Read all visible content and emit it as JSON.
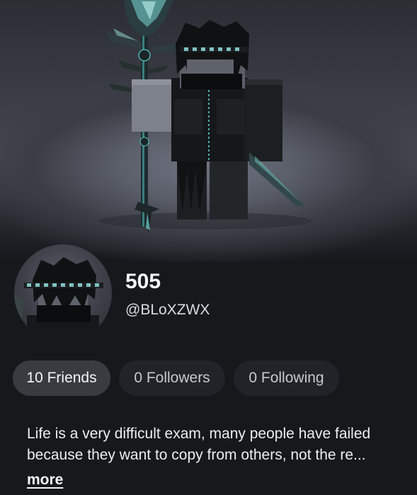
{
  "profile": {
    "display_name": "505",
    "username": "@BLoXZWX"
  },
  "stats": {
    "friends_label": "10 Friends",
    "followers_label": "0 Followers",
    "following_label": "0 Following",
    "active": "friends"
  },
  "bio": {
    "text": "Life is a very difficult exam, many people have failed because they want to copy from others, not the re...",
    "more_label": "more"
  },
  "colors": {
    "background": "#17181c",
    "pill_active": "#393b41",
    "pill_inactive": "#222328",
    "text_primary": "#f4f5f7",
    "accent_teal": "#6fd4d0"
  },
  "icons": {
    "hero": "avatar-render",
    "staff": "staff-icon",
    "headshot": "avatar-headshot"
  }
}
